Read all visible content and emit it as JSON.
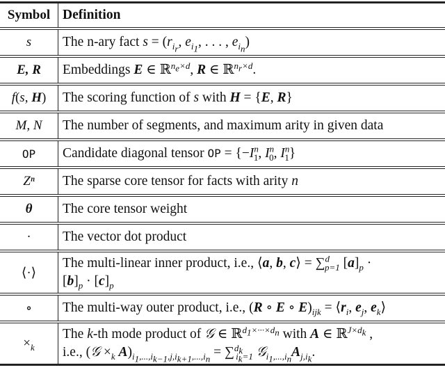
{
  "header": {
    "symbol": "Symbol",
    "definition": "Definition"
  },
  "rows": [
    {
      "symbol": "s",
      "definition": "The n-ary fact s = (r_{i_r}, e_{i_1}, . . . , e_{i_n})"
    },
    {
      "symbol": "E, R",
      "definition": "Embeddings E ∈ ℝ^{n_e×d}, R ∈ ℝ^{n_r×d}."
    },
    {
      "symbol": "f(s, H)",
      "definition": "The scoring function of s with H = {E, R}"
    },
    {
      "symbol": "M, N",
      "definition": "The number of segments, and maximum arity in given data"
    },
    {
      "symbol": "OP",
      "definition": "Candidate diagonal tensor OP = {−I_1^n, I_0^n, I_1^n}"
    },
    {
      "symbol": "Zⁿ",
      "definition": "The sparse core tensor for facts with arity n"
    },
    {
      "symbol": "θ",
      "definition": "The core tensor weight"
    },
    {
      "symbol": "·",
      "definition": "The vector dot product"
    },
    {
      "symbol": "⟨·⟩",
      "definition": "The multi-linear inner product, i.e., ⟨a, b, c⟩ = Σ_{p=1}^{d} [a]_p · [b]_p · [c]_p"
    },
    {
      "symbol": "∘",
      "definition": "The multi-way outer product, i.e., (R ∘ E ∘ E)_{ijk} = ⟨r_i, e_j, e_k⟩"
    },
    {
      "symbol": "×_k",
      "definition": "The k-th mode product of G ∈ ℝ^{d_1×···×d_n} with A ∈ ℝ^{J×d_k}, i.e., (G ×_k A)_{i_1,...,i_{k−1},j,i_{k+1},...,i_n} = Σ_{i_k=1}^{d_k} G_{i_1,...,i_n} A_{j,i_k}."
    }
  ],
  "text": {
    "r0": "The n-ary fact ",
    "r1": "Embeddings ",
    "r2": "The scoring function of ",
    "r2b": " with ",
    "r3": "The number of segments, and maximum arity in given data",
    "r4": "Candidate diagonal tensor ",
    "r5": "The sparse core tensor for facts with arity ",
    "r6": "The core tensor weight",
    "r7": "The vector dot product",
    "r8a": "The multi-linear inner product, i.e., ",
    "r9": "The multi-way outer product, i.e., ",
    "r10a": "The ",
    "r10b": "-th mode product of ",
    "r10c": " with ",
    "r10d": "i.e., "
  }
}
